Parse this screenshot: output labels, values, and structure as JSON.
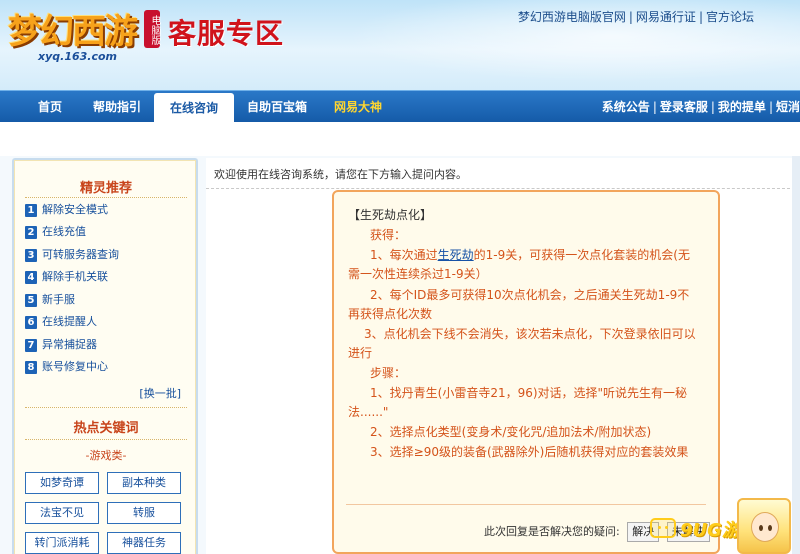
{
  "header": {
    "logo_text": "梦幻西游",
    "logo_tag": "电脑版",
    "logo_url": "xyq.163.com",
    "title": "客服专区",
    "top_links": [
      "梦幻西游电脑版官网",
      "网易通行证",
      "官方论坛"
    ]
  },
  "nav": {
    "items": [
      "首页",
      "帮助指引",
      "在线咨询",
      "自助百宝箱",
      "网易大神"
    ],
    "active_index": 2,
    "right_links": [
      "系统公告",
      "登录客服",
      "我的提单",
      "短消"
    ]
  },
  "sidebar": {
    "rec_title": "精灵推荐",
    "rec_items": [
      {
        "num": "1",
        "label": "解除安全模式"
      },
      {
        "num": "2",
        "label": "在线充值"
      },
      {
        "num": "3",
        "label": "可转服务器查询"
      },
      {
        "num": "4",
        "label": "解除手机关联"
      },
      {
        "num": "5",
        "label": "新手服"
      },
      {
        "num": "6",
        "label": "在线提醒人"
      },
      {
        "num": "7",
        "label": "异常捕捉器"
      },
      {
        "num": "8",
        "label": "账号修复中心"
      }
    ],
    "refresh_label": "[换一批]",
    "kw_title": "热点关键词",
    "kw_category": "-游戏类-",
    "keywords": [
      "如梦奇谭",
      "副本种类",
      "法宝不见",
      "转服",
      "转门派消耗",
      "神器任务"
    ]
  },
  "main": {
    "welcome": "欢迎使用在线咨询系统，请您在下方输入提问内容。",
    "answer": {
      "heading": "【生死劫点化】",
      "gain_label": "获得：",
      "gain_1_pre": "1、每次通过",
      "gain_1_link": "生死劫",
      "gain_1_post": "的1-9关，可获得一次点化套装的机会(无",
      "gain_1_cont": "需一次性连续杀过1-9关）",
      "gain_2": "2、每个ID最多可获得10次点化机会，之后通关生死劫1-9不",
      "gain_2_cont": "再获得点化次数",
      "gain_3": "3、点化机会下线不会消失，该次若未点化，下次登录依旧可以",
      "gain_3_cont": "进行",
      "steps_label": "步骤：",
      "step_1": "1、找丹青生(小雷音寺21，96)对话，选择\"听说先生有一秘",
      "step_1_cont": "法......\"",
      "step_2": "2、选择点化类型(变身术/变化咒/追加法术/附加状态)",
      "step_3": "3、选择≥90级的装备(武器除外)后随机获得对应的套装效果"
    },
    "feedback_prompt": "此次回复是否解决您的疑问:",
    "feedback_yes": "解决",
    "feedback_no": "未解决"
  },
  "watermark": "9UG游戏"
}
